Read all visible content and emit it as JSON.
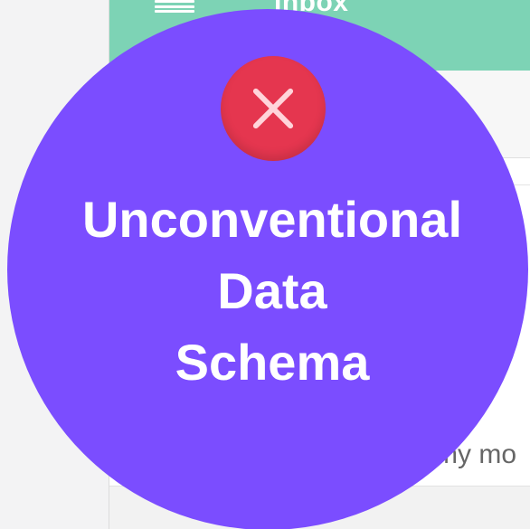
{
  "app": {
    "title": "Inbox",
    "message_snippet": "my mo"
  },
  "overlay": {
    "status_icon": "close-icon",
    "label_lines": [
      "Unconventional",
      "Data",
      "Schema"
    ],
    "colors": {
      "badge": "#7b4dff",
      "error": "#e5364f",
      "app_bar": "#7dd3b5"
    }
  }
}
